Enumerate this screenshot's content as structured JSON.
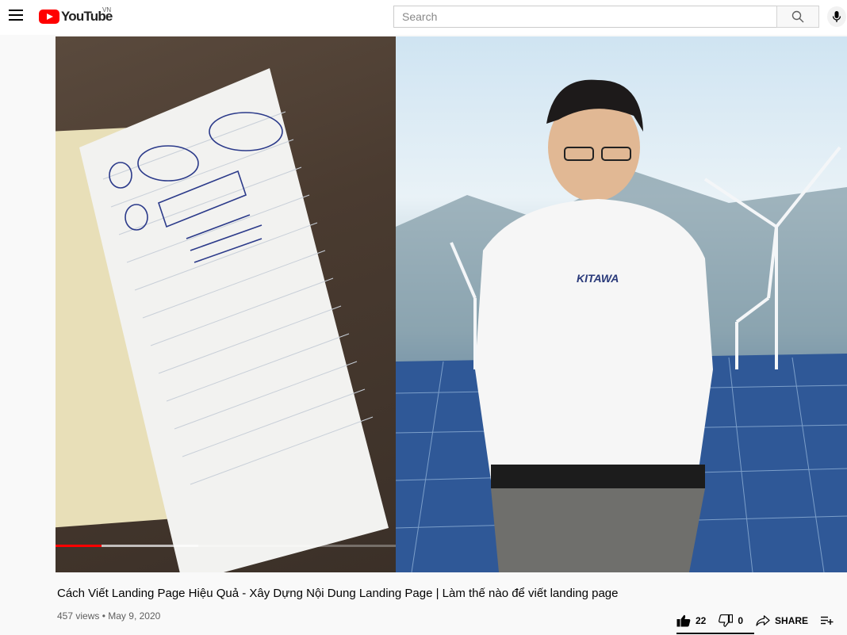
{
  "header": {
    "logo_text": "YouTube",
    "region": "VN",
    "search_placeholder": "Search"
  },
  "player": {
    "progress_played_fraction": 0.135,
    "progress_buffered_fraction": 0.42
  },
  "video": {
    "title": "Cách Viết Landing Page Hiệu Quả - Xây Dựng Nội Dung Landing Page | Làm thế nào để viết landing page",
    "views": "457 views",
    "separator": "•",
    "date": "May 9, 2020",
    "likes": "22",
    "dislikes": "0",
    "share_label": "SHARE"
  },
  "icons": [
    "menu-icon",
    "youtube-logo-icon",
    "search-icon",
    "mic-icon",
    "thumb-up-icon",
    "thumb-down-icon",
    "share-icon",
    "save-playlist-icon"
  ],
  "colors": {
    "brand": "#ff0000",
    "text": "#030303",
    "secondary": "#606060"
  }
}
